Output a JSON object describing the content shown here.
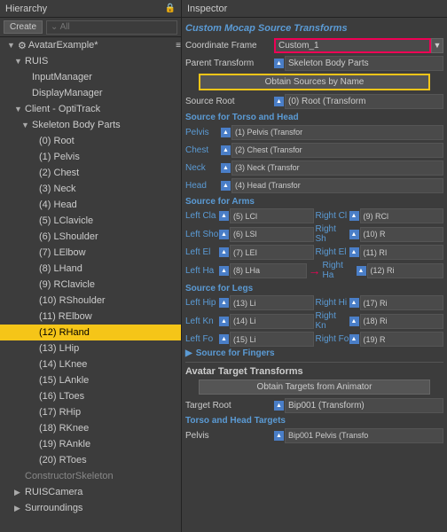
{
  "hierarchy": {
    "title": "Hierarchy",
    "create_btn": "Create",
    "search_placeholder": "⌄ All",
    "items": [
      {
        "id": "avatar",
        "label": "AvatarExample*",
        "indent": 1,
        "arrow": "▼",
        "has_icon": true,
        "selected": false,
        "highlighted": false
      },
      {
        "id": "ruis",
        "label": "RUIS",
        "indent": 2,
        "arrow": "▼",
        "selected": false,
        "highlighted": false
      },
      {
        "id": "inputmanager",
        "label": "InputManager",
        "indent": 3,
        "arrow": "",
        "selected": false,
        "highlighted": false
      },
      {
        "id": "displaymanager",
        "label": "DisplayManager",
        "indent": 3,
        "arrow": "",
        "selected": false,
        "highlighted": false
      },
      {
        "id": "client",
        "label": "Client - OptiTrack",
        "indent": 2,
        "arrow": "▼",
        "selected": false,
        "highlighted": false
      },
      {
        "id": "skeleton",
        "label": "Skeleton Body Parts",
        "indent": 3,
        "arrow": "▼",
        "selected": false,
        "highlighted": false
      },
      {
        "id": "root",
        "label": "(0) Root",
        "indent": 4,
        "arrow": "",
        "selected": false,
        "highlighted": false
      },
      {
        "id": "pelvis",
        "label": "(1) Pelvis",
        "indent": 4,
        "arrow": "",
        "selected": false,
        "highlighted": false
      },
      {
        "id": "chest",
        "label": "(2) Chest",
        "indent": 4,
        "arrow": "",
        "selected": false,
        "highlighted": false
      },
      {
        "id": "neck",
        "label": "(3) Neck",
        "indent": 4,
        "arrow": "",
        "selected": false,
        "highlighted": false
      },
      {
        "id": "head",
        "label": "(4) Head",
        "indent": 4,
        "arrow": "",
        "selected": false,
        "highlighted": false
      },
      {
        "id": "lclavicle",
        "label": "(5) LClavicle",
        "indent": 4,
        "arrow": "",
        "selected": false,
        "highlighted": false
      },
      {
        "id": "lshoulder",
        "label": "(6) LShoulder",
        "indent": 4,
        "arrow": "",
        "selected": false,
        "highlighted": false
      },
      {
        "id": "lelbow",
        "label": "(7) LElbow",
        "indent": 4,
        "arrow": "",
        "selected": false,
        "highlighted": false
      },
      {
        "id": "lhand",
        "label": "(8) LHand",
        "indent": 4,
        "arrow": "",
        "selected": false,
        "highlighted": false
      },
      {
        "id": "rclavicle",
        "label": "(9) RClavicle",
        "indent": 4,
        "arrow": "",
        "selected": false,
        "highlighted": false
      },
      {
        "id": "rshoulder",
        "label": "(10) RShoulder",
        "indent": 4,
        "arrow": "",
        "selected": false,
        "highlighted": false
      },
      {
        "id": "relbow",
        "label": "(11) RElbow",
        "indent": 4,
        "arrow": "",
        "selected": false,
        "highlighted": false
      },
      {
        "id": "rhand",
        "label": "(12) RHand",
        "indent": 4,
        "arrow": "",
        "selected": false,
        "highlighted": true
      },
      {
        "id": "lhip",
        "label": "(13) LHip",
        "indent": 4,
        "arrow": "",
        "selected": false,
        "highlighted": false
      },
      {
        "id": "lknee",
        "label": "(14) LKnee",
        "indent": 4,
        "arrow": "",
        "selected": false,
        "highlighted": false
      },
      {
        "id": "lankle",
        "label": "(15) LAnkle",
        "indent": 4,
        "arrow": "",
        "selected": false,
        "highlighted": false
      },
      {
        "id": "ltoes",
        "label": "(16) LToes",
        "indent": 4,
        "arrow": "",
        "selected": false,
        "highlighted": false
      },
      {
        "id": "rhip",
        "label": "(17) RHip",
        "indent": 4,
        "arrow": "",
        "selected": false,
        "highlighted": false
      },
      {
        "id": "rknee",
        "label": "(18) RKnee",
        "indent": 4,
        "arrow": "",
        "selected": false,
        "highlighted": false
      },
      {
        "id": "rankle",
        "label": "(19) RAnkle",
        "indent": 4,
        "arrow": "",
        "selected": false,
        "highlighted": false
      },
      {
        "id": "rtoes",
        "label": "(20) RToes",
        "indent": 4,
        "arrow": "",
        "selected": false,
        "highlighted": false
      },
      {
        "id": "constructor",
        "label": "ConstructorSkeleton",
        "indent": 2,
        "arrow": "",
        "selected": false,
        "highlighted": false,
        "gray": true
      },
      {
        "id": "ruiscamera",
        "label": "RUISCamera",
        "indent": 2,
        "arrow": "▶",
        "selected": false,
        "highlighted": false
      },
      {
        "id": "surroundings",
        "label": "Surroundings",
        "indent": 2,
        "arrow": "▶",
        "selected": false,
        "highlighted": false
      }
    ]
  },
  "inspector": {
    "title": "Inspector",
    "component_title": "Custom Mocap Source Transforms",
    "coord_frame_label": "Coordinate Frame",
    "coord_frame_value": "Custom_1",
    "parent_transform_label": "Parent Transform",
    "parent_transform_value": "Skeleton Body Parts",
    "obtain_btn": "Obtain Sources by Name",
    "source_root_label": "Source Root",
    "source_root_value": "(0) Root (Transform",
    "torso_head_title": "Source for Torso and Head",
    "pelvis_label": "Pelvis",
    "pelvis_value": "(1) Pelvis (Transfor",
    "chest_label": "Chest",
    "chest_value": "(2) Chest (Transfor",
    "neck_label": "Neck",
    "neck_value": "(3) Neck (Transfor",
    "head_label": "Head",
    "head_value": "(4) Head (Transfor",
    "arms_title": "Source for Arms",
    "left_cla_label": "Left Cla",
    "left_cla_value": "(5) LCl",
    "right_cl_label": "Right Cl",
    "right_cl_value": "(9) RCl",
    "left_sho_label": "Left Sho",
    "left_sho_value": "(6) LSl",
    "right_sh_label": "Right Sh",
    "right_sh_value": "(10) R",
    "left_el_label": "Left El",
    "left_el_value": "(7) LEI",
    "right_el_label": "Right El",
    "right_el_value": "(11) RI",
    "left_ha_label": "Left Ha",
    "left_ha_value": "(8) LHa",
    "right_ha_label": "Right Ha",
    "right_ha_value": "(12) Ri",
    "legs_title": "Source for Legs",
    "left_hip_label": "Left Hip",
    "left_hip_value": "(13) Li",
    "right_hi_label": "Right Hi",
    "right_hi_value": "(17) Ri",
    "left_kn_label": "Left Kn",
    "left_kn_value": "(14) Li",
    "right_kn_label": "Right Kn",
    "right_kn_value": "(18) Ri",
    "left_fo_label": "Left Fo",
    "left_fo_value": "(15) Li",
    "right_fo_label": "Right Fo",
    "right_fo_value": "(19) R",
    "fingers_title": "Source for Fingers",
    "avatar_targets_title": "Avatar Target Transforms",
    "obtain_targets_btn": "Obtain Targets from Animator",
    "target_root_label": "Target Root",
    "target_root_value": "Bip001 (Transform)",
    "torso_head_targets_title": "Torso and Head Targets",
    "pelvis_target_label": "Pelvis",
    "pelvis_target_value": "Bip001 Pelvis (Transfo"
  }
}
